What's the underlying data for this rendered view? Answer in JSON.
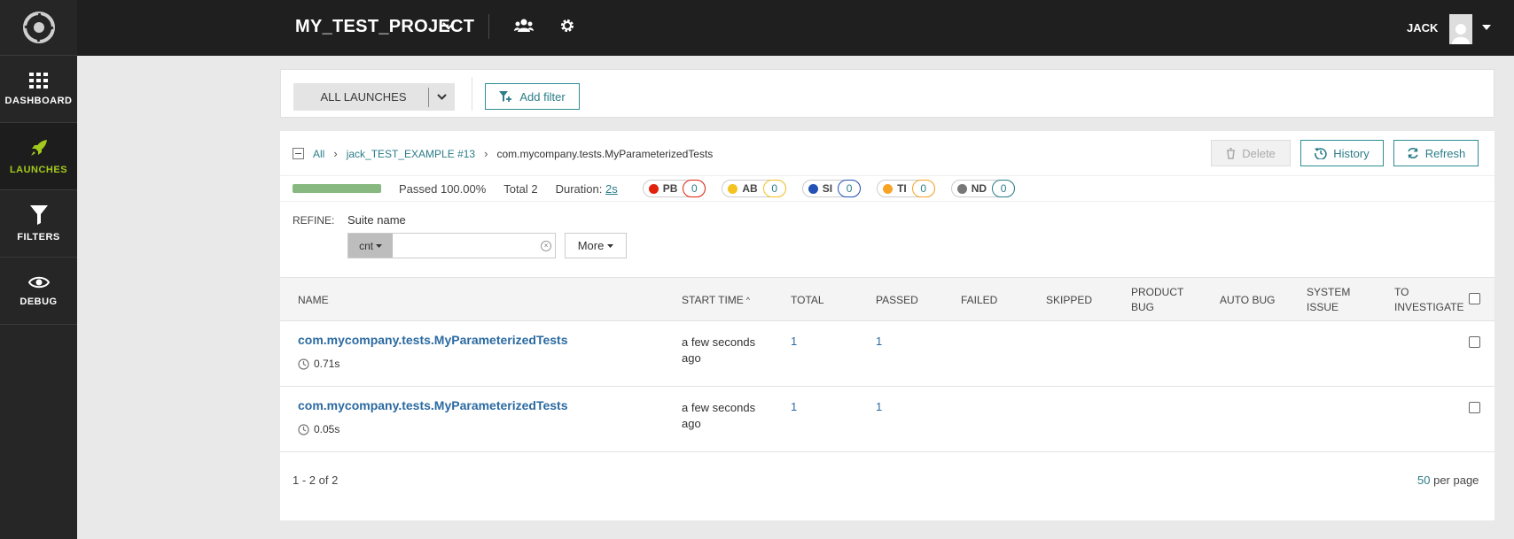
{
  "sidebar": {
    "items": [
      {
        "label": "DASHBOARD",
        "icon": "grid-icon"
      },
      {
        "label": "LAUNCHES",
        "icon": "rocket-icon",
        "active": true
      },
      {
        "label": "FILTERS",
        "icon": "filter-icon"
      },
      {
        "label": "DEBUG",
        "icon": "eye-icon"
      }
    ]
  },
  "header": {
    "project": "MY_TEST_PROJECT",
    "user": "JACK"
  },
  "filter_bar": {
    "launches_label": "ALL LAUNCHES",
    "add_filter_label": "Add filter"
  },
  "breadcrumb": {
    "all": "All",
    "launch": "jack_TEST_EXAMPLE #13",
    "current": "com.mycompany.tests.MyParameterizedTests"
  },
  "actions": {
    "delete": "Delete",
    "history": "History",
    "refresh": "Refresh"
  },
  "stats": {
    "progress_percent": 100,
    "passed": "Passed 100.00%",
    "total": "Total 2",
    "duration_label": "Duration:",
    "duration_value": "2s",
    "defects": [
      {
        "code": "PB",
        "count": "0",
        "color": "#e1230e",
        "border": "#e1230e"
      },
      {
        "code": "AB",
        "count": "0",
        "color": "#f5c321",
        "border": "#f5c321"
      },
      {
        "code": "SI",
        "count": "0",
        "color": "#2451b5",
        "border": "#2451b5"
      },
      {
        "code": "TI",
        "count": "0",
        "color": "#f7a425",
        "border": "#f7a425"
      },
      {
        "code": "ND",
        "count": "0",
        "color": "#777777",
        "border": "#2c7d89"
      }
    ]
  },
  "refine": {
    "label": "REFINE:",
    "suite_label": "Suite name",
    "condition": "cnt",
    "input_value": "",
    "more": "More"
  },
  "table": {
    "headers": {
      "name": "NAME",
      "start_time": "START TIME",
      "sort_indicator": "^",
      "total": "TOTAL",
      "passed": "PASSED",
      "failed": "FAILED",
      "skipped": "SKIPPED",
      "product_bug_1": "PRODUCT",
      "product_bug_2": "BUG",
      "auto_bug": "AUTO BUG",
      "system_issue_1": "SYSTEM",
      "system_issue_2": "ISSUE",
      "to_investigate_1": "TO",
      "to_investigate_2": "INVESTIGATE"
    },
    "rows": [
      {
        "name": "com.mycompany.tests.MyParameterizedTests",
        "duration": "0.71s",
        "start_1": "a few seconds",
        "start_2": "ago",
        "total": "1",
        "passed": "1"
      },
      {
        "name": "com.mycompany.tests.MyParameterizedTests",
        "duration": "0.05s",
        "start_1": "a few seconds",
        "start_2": "ago",
        "total": "1",
        "passed": "1"
      }
    ]
  },
  "footer": {
    "range": "1 - 2 of 2",
    "per_page_count": "50",
    "per_page_label": "per page"
  }
}
